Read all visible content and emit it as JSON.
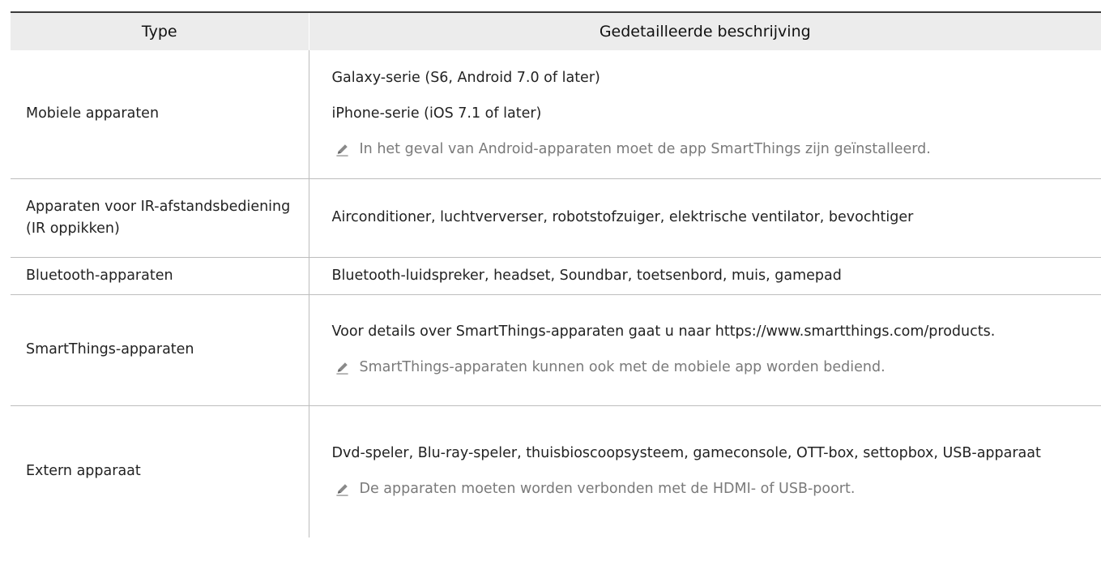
{
  "table": {
    "headers": {
      "type": "Type",
      "description": "Gedetailleerde beschrijving"
    },
    "rows": [
      {
        "type": "Mobiele apparaten",
        "paragraphs": [
          "Galaxy-serie (S6, Android 7.0 of later)",
          "iPhone-serie (iOS 7.1 of later)"
        ],
        "note": "In het geval van Android-apparaten moet de app SmartThings zijn geïnstalleerd."
      },
      {
        "type": "Apparaten voor IR-afstandsbediening (IR oppikken)",
        "paragraphs": [
          "Airconditioner, luchtververser, robotstofzuiger, elektrische ventilator, bevochtiger"
        ]
      },
      {
        "type": "Bluetooth-apparaten",
        "paragraphs": [
          "Bluetooth-luidspreker, headset, Soundbar, toetsenbord, muis, gamepad"
        ]
      },
      {
        "type": "SmartThings-apparaten",
        "paragraphs": [
          "Voor details over SmartThings-apparaten gaat u naar https://www.smartthings.com/products."
        ],
        "note": "SmartThings-apparaten kunnen ook met de mobiele app worden bediend."
      },
      {
        "type": "Extern apparaat",
        "paragraphs": [
          "Dvd-speler, Blu-ray-speler, thuisbioscoopsysteem, gameconsole, OTT-box, settopbox, USB-apparaat"
        ],
        "note": "De apparaten moeten worden verbonden met de HDMI- of USB-poort."
      }
    ]
  },
  "icons": {
    "note": "pencil-icon"
  },
  "colors": {
    "header_background": "#ececec",
    "header_rule": "#3a3a3a",
    "grid_lines": "#bdbdbd",
    "note_text": "#7a7a7a"
  }
}
